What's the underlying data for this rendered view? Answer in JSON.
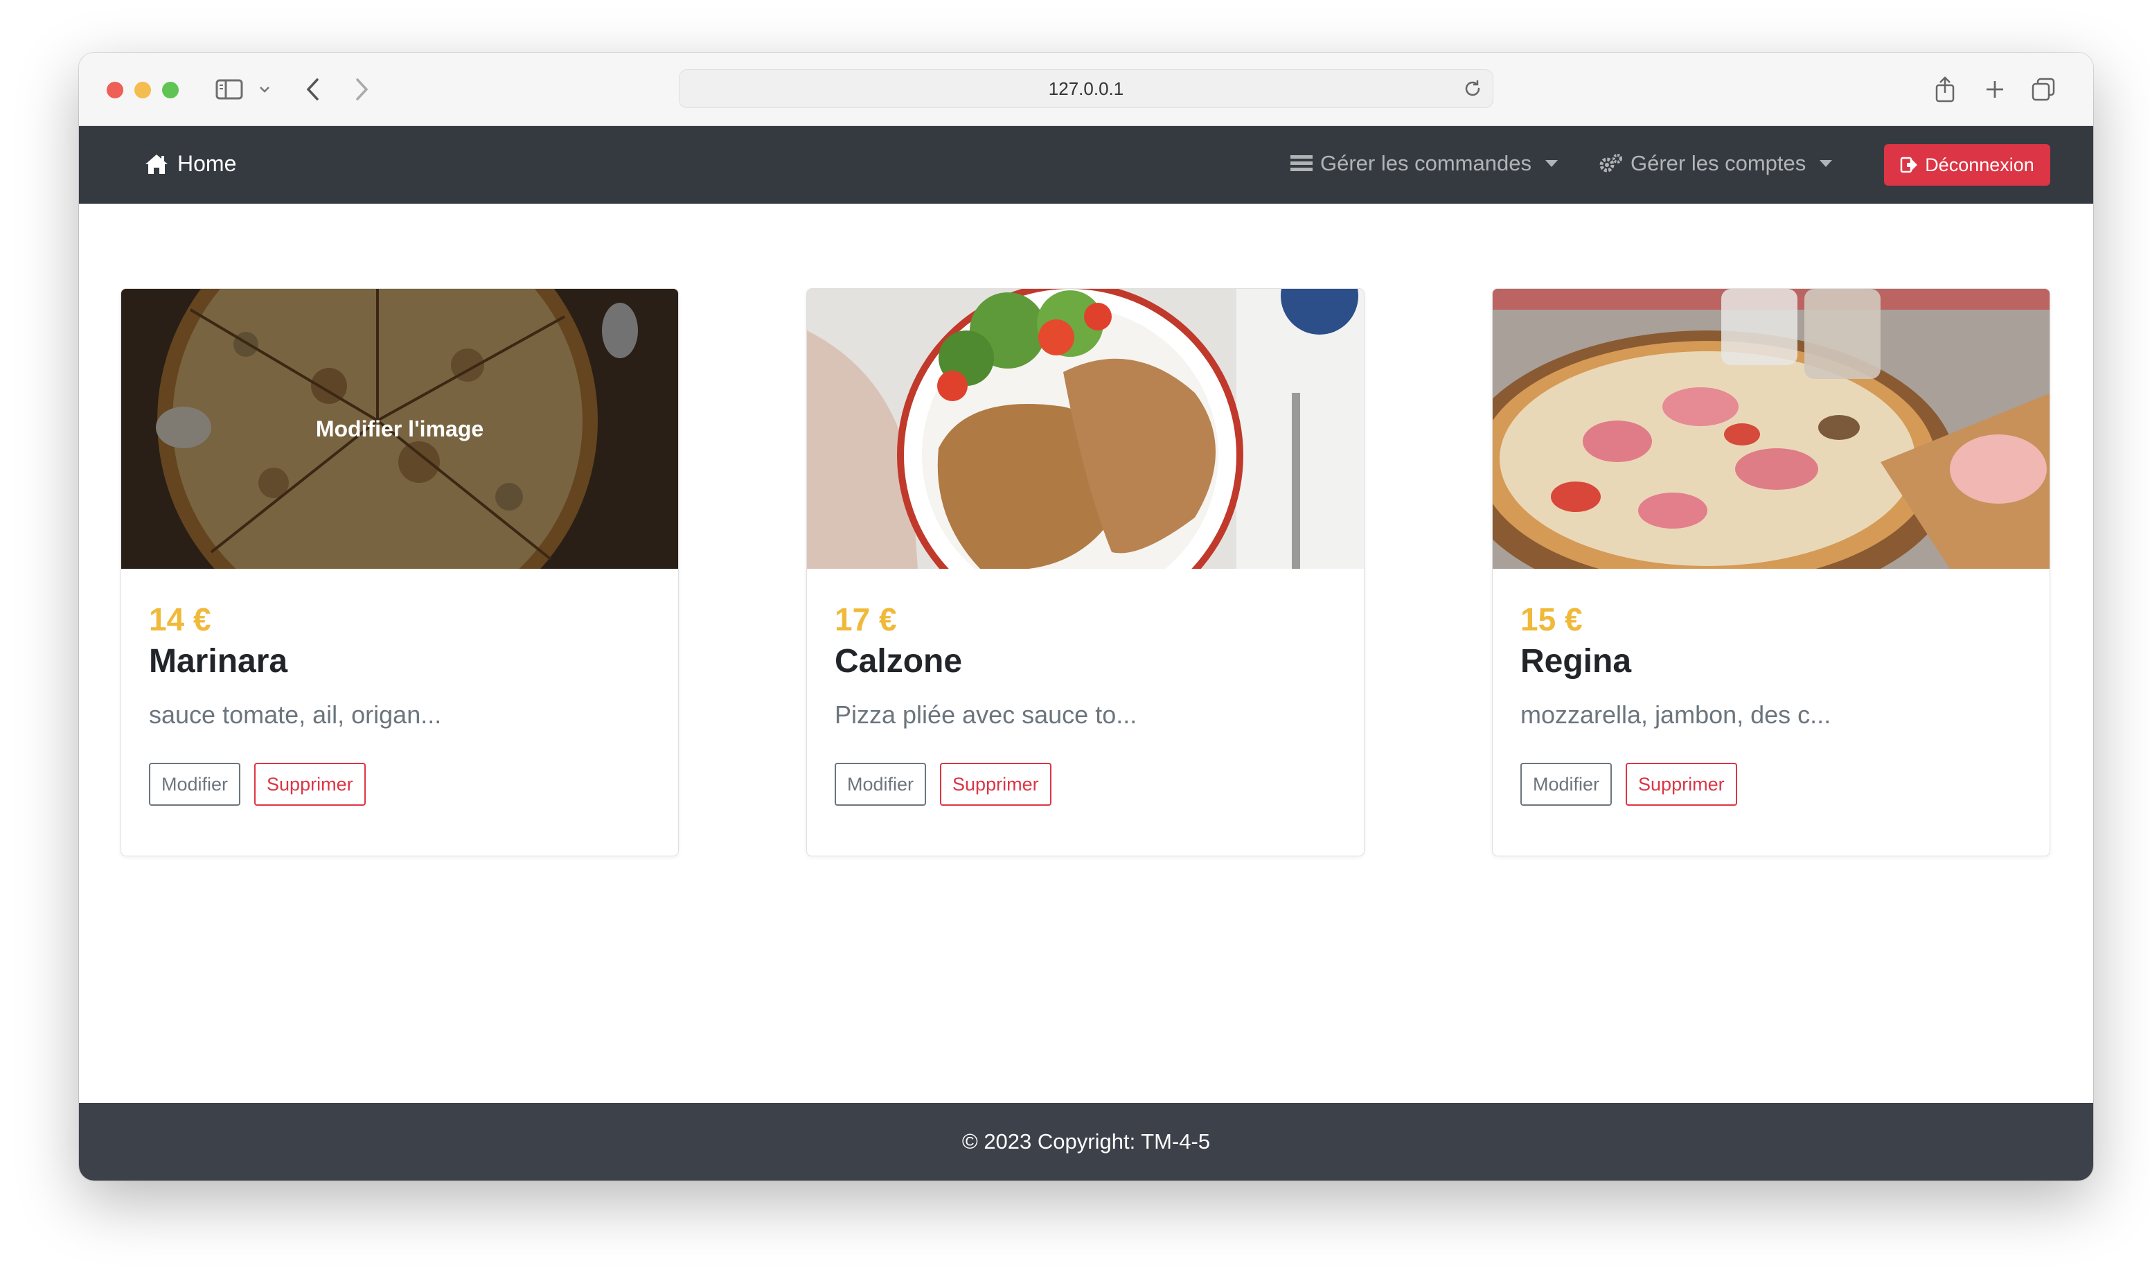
{
  "browser": {
    "url": "127.0.0.1"
  },
  "navbar": {
    "brand": "Home",
    "orders_menu": "Gérer les commandes",
    "accounts_menu": "Gérer les comptes",
    "logout": "Déconnexion"
  },
  "cards": [
    {
      "price": "14 €",
      "name": "Marinara",
      "description": "sauce tomate, ail, origan...",
      "overlay": "Modifier l'image",
      "edit_label": "Modifier",
      "delete_label": "Supprimer"
    },
    {
      "price": "17 €",
      "name": "Calzone",
      "description": "Pizza pliée avec sauce to...",
      "edit_label": "Modifier",
      "delete_label": "Supprimer"
    },
    {
      "price": "15 €",
      "name": "Regina",
      "description": "mozzarella, jambon, des c...",
      "edit_label": "Modifier",
      "delete_label": "Supprimer"
    }
  ],
  "footer": {
    "text": "© 2023 Copyright: TM-4-5"
  },
  "colors": {
    "navbar": "#343a40",
    "footer": "#3c414a",
    "price": "#f0b93a",
    "danger": "#dc3545",
    "secondary": "#6c757d"
  }
}
